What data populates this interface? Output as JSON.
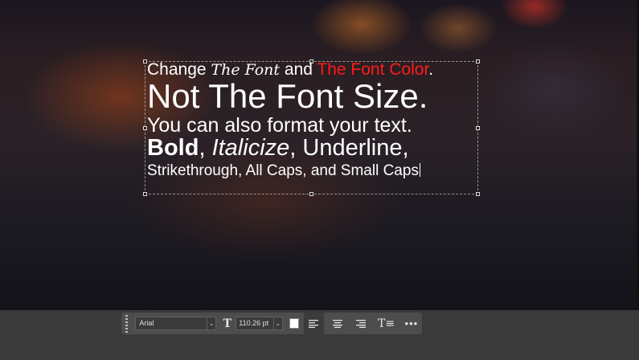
{
  "canvas": {
    "text_layer": {
      "line1": {
        "part1": "Change ",
        "part2": "The Font",
        "part3": " and ",
        "part4": "The Font Color",
        "part5": "."
      },
      "line2": "Not The Font Size.",
      "line3": "You can also format your text.",
      "line4": {
        "bold": "Bold",
        "sep1": ", ",
        "italic": "Italicize",
        "rest": ", Underline,"
      },
      "line5": "Strikethrough, All Caps, and Small Caps"
    },
    "accent_text_color": "#ff1a1a"
  },
  "toolbar": {
    "font_family": "Arial",
    "font_dropdown_icon": "chevron-down-icon",
    "font_size_icon": "text-size-icon",
    "font_size": "110.26 pt",
    "size_dropdown_icon": "chevron-down-icon",
    "text_color": "#ffffff",
    "align_left_icon": "align-left-icon",
    "align_center_icon": "align-center-icon",
    "align_right_icon": "align-right-icon",
    "text_options_icon": "text-options-icon",
    "more_icon": "more-icon"
  }
}
